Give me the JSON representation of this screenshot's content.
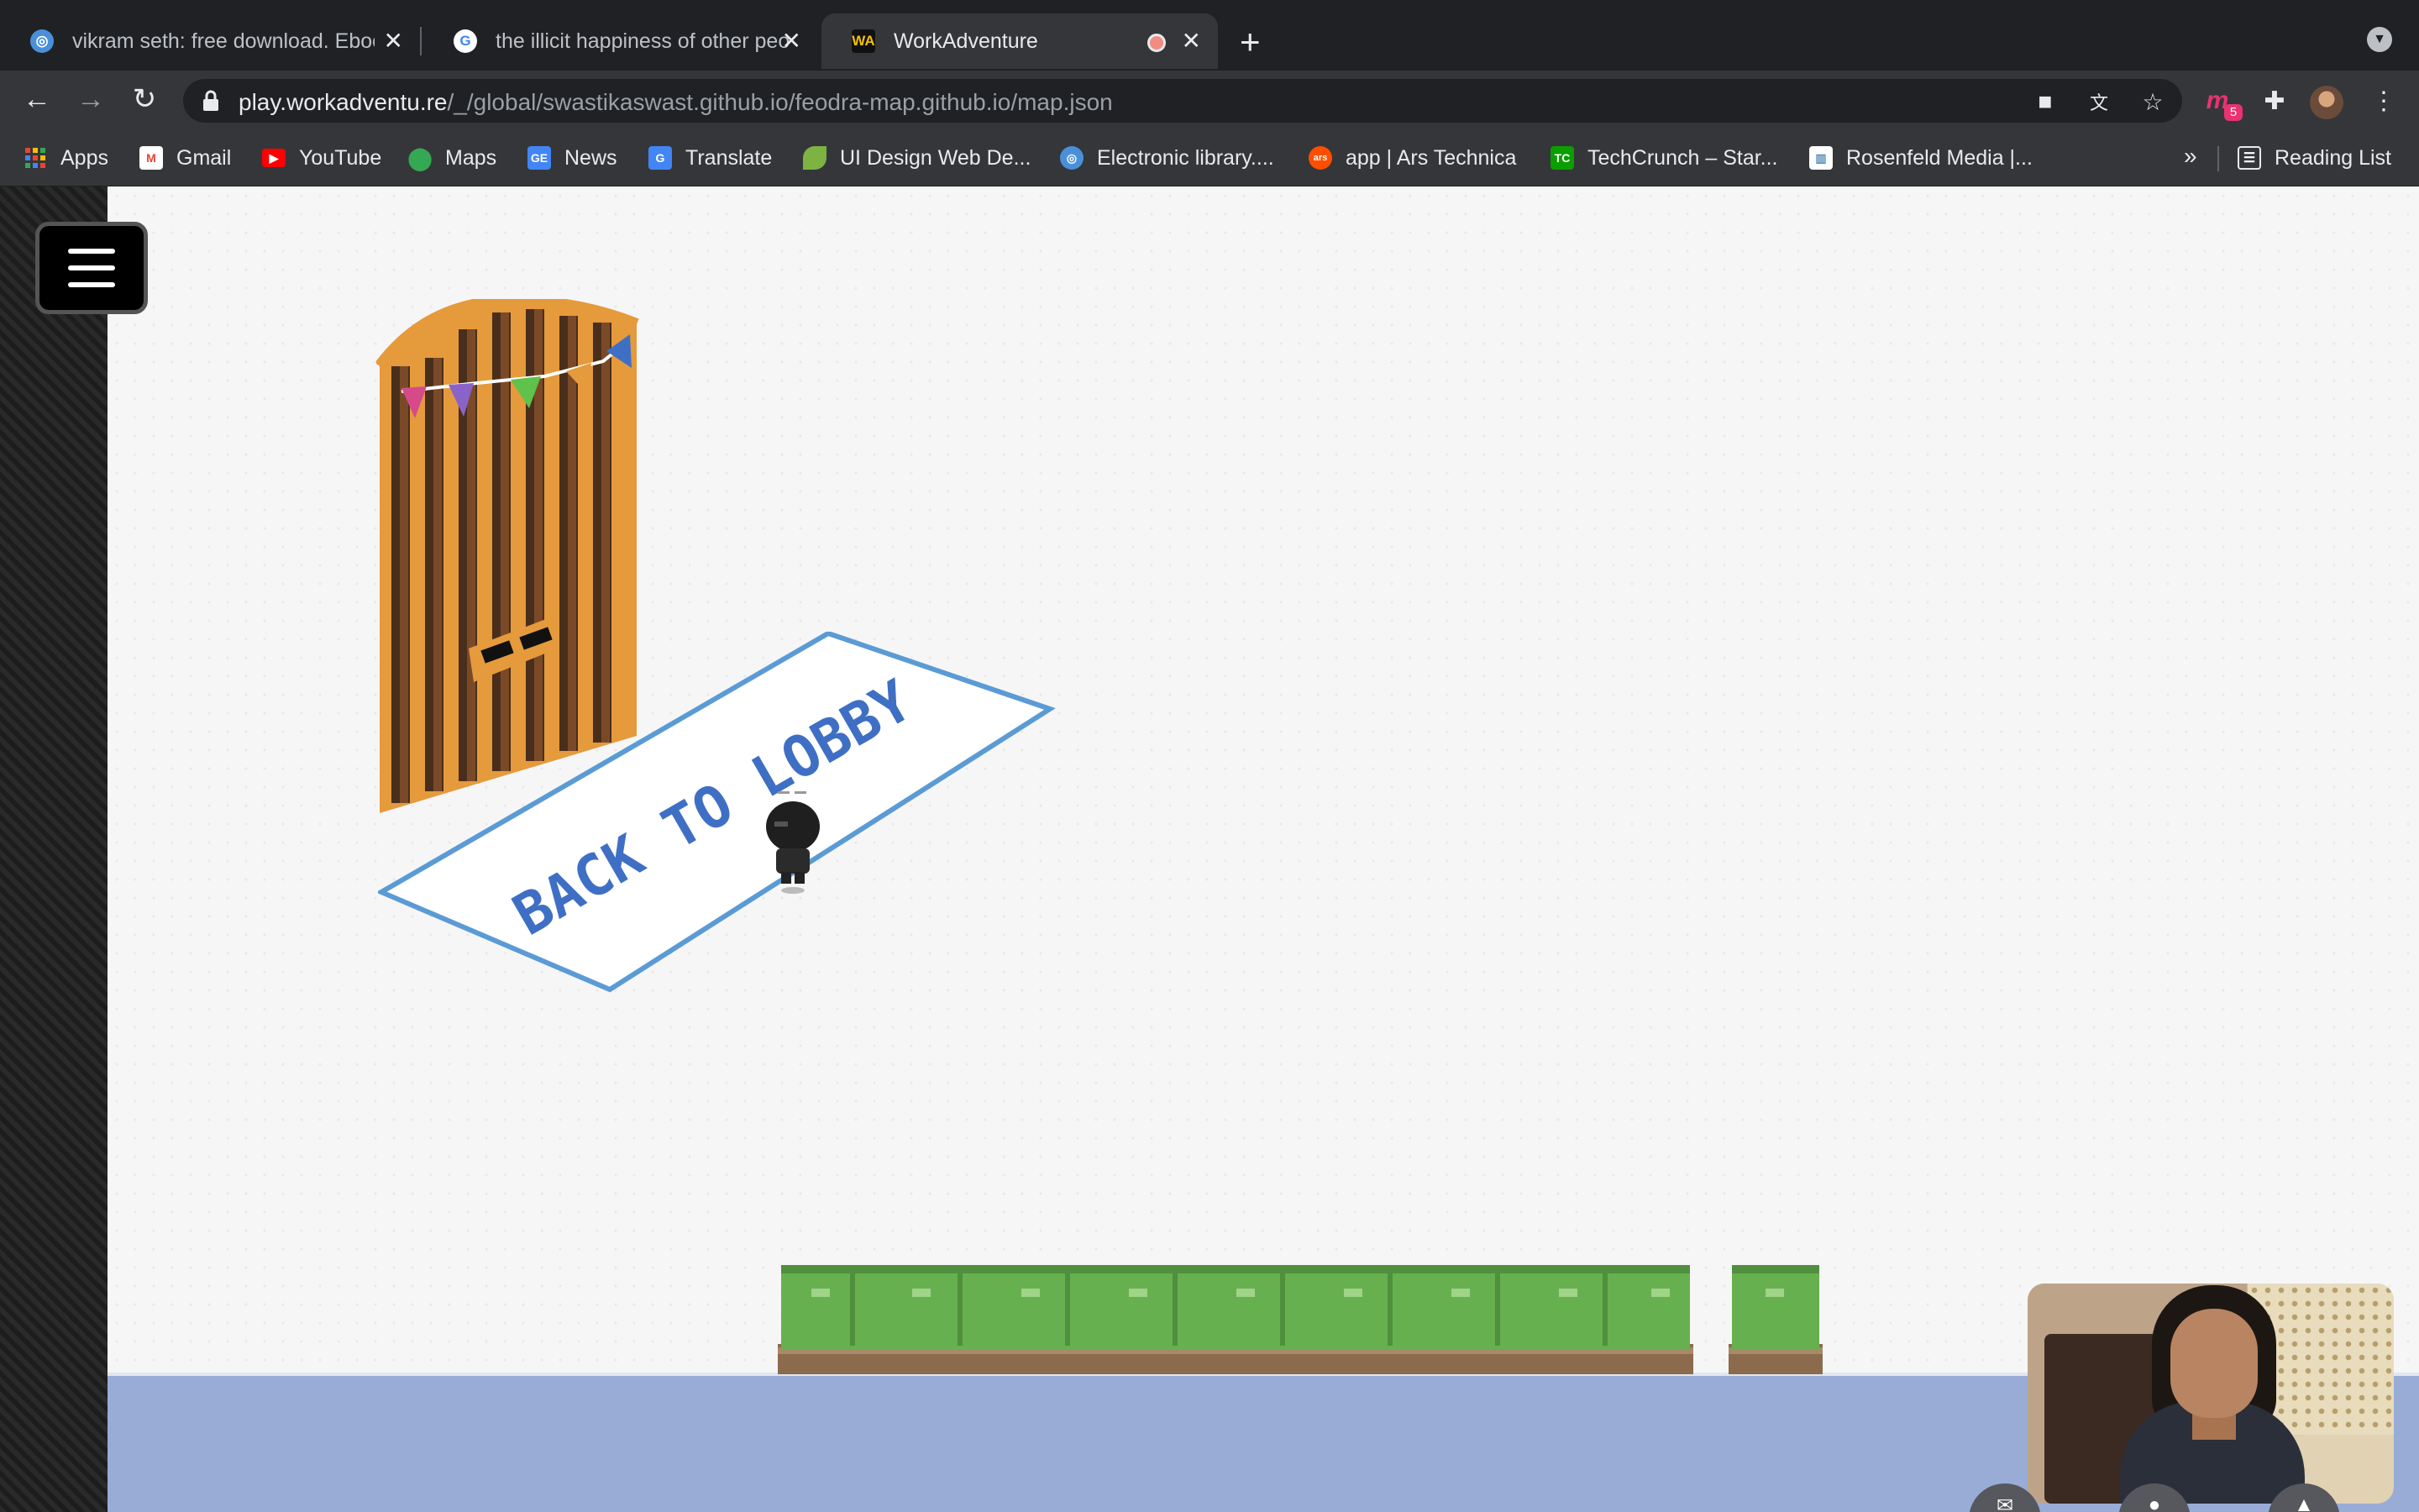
{
  "tabs": [
    {
      "title": "vikram seth: free download. Ebooks",
      "favicon": "archive-icon",
      "active": false
    },
    {
      "title": "the illicit happiness of other people",
      "favicon": "google-icon",
      "active": false
    },
    {
      "title": "WorkAdventure",
      "favicon": "workadventure-icon",
      "active": true,
      "recording": true
    }
  ],
  "toolbar": {
    "url_host": "play.workadventu.re",
    "url_path": "/_/global/swastikaswast.github.io/feodra-map.github.io/map.json",
    "extension_badge": "5"
  },
  "bookmarks": [
    {
      "label": "Apps",
      "icon": "apps-grid-icon",
      "color": "#4285f4"
    },
    {
      "label": "Gmail",
      "icon": "gmail-icon",
      "color": "#ea4335"
    },
    {
      "label": "YouTube",
      "icon": "youtube-icon",
      "color": "#ff0000"
    },
    {
      "label": "Maps",
      "icon": "maps-pin-icon",
      "color": "#34a853"
    },
    {
      "label": "News",
      "icon": "google-news-icon",
      "color": "#4285f4"
    },
    {
      "label": "Translate",
      "icon": "google-translate-icon",
      "color": "#4285f4"
    },
    {
      "label": "UI Design Web De...",
      "icon": "leaf-icon",
      "color": "#7cb342"
    },
    {
      "label": "Electronic library....",
      "icon": "archive-icon",
      "color": "#4a90d9"
    },
    {
      "label": "app | Ars Technica",
      "icon": "ars-technica-icon",
      "color": "#ff4e00"
    },
    {
      "label": "TechCrunch – Star...",
      "icon": "techcrunch-icon",
      "color": "#0a9e01"
    },
    {
      "label": "Rosenfeld Media |...",
      "icon": "rosenfeld-media-icon",
      "color": "#5b8fb9"
    }
  ],
  "reading_list": "Reading List",
  "game": {
    "mat_text": "BACK TO LOBBY",
    "colors": {
      "floor": "#f6f6f6",
      "water": "#98acd6",
      "mat_border": "#5b9bd5",
      "mat_text": "#3f6fc4"
    }
  }
}
